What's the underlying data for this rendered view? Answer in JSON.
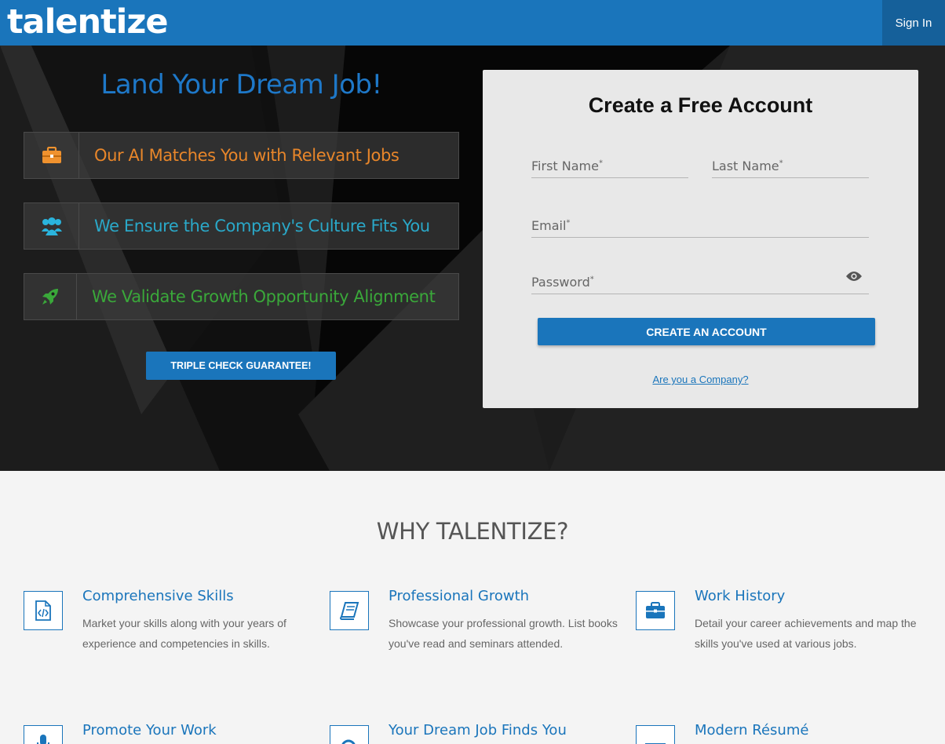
{
  "header": {
    "logo": "talentize",
    "signin_label": "Sign In"
  },
  "hero": {
    "title": "Land Your Dream Job!",
    "features": [
      {
        "icon": "briefcase-icon",
        "text": "Our AI Matches You with Relevant Jobs",
        "color": "#e8862a"
      },
      {
        "icon": "users-icon",
        "text": "We Ensure the Company's Culture Fits You",
        "color": "#2aa8c8"
      },
      {
        "icon": "rocket-icon",
        "text": "We Validate Growth Opportunity Alignment",
        "color": "#3aa83a"
      }
    ],
    "guarantee_label": "TRIPLE CHECK GUARANTEE!"
  },
  "form": {
    "title": "Create a Free Account",
    "first_name": "First Name",
    "last_name": "Last Name",
    "email": "Email",
    "password": "Password",
    "required_mark": "*",
    "submit_label": "CREATE AN ACCOUNT",
    "company_link": "Are you a Company?"
  },
  "why": {
    "title": "WHY TALENTIZE?",
    "items": [
      {
        "icon": "code-file-icon",
        "title": "Comprehensive Skills",
        "desc": "Market your skills along with your years of experience and competencies in skills."
      },
      {
        "icon": "book-icon",
        "title": "Professional Growth",
        "desc": "Showcase your professional growth. List books you've read and seminars attended."
      },
      {
        "icon": "briefcase-icon",
        "title": "Work History",
        "desc": "Detail your career achievements and map the skills you've used at various jobs."
      },
      {
        "icon": "microphone-icon",
        "title": "Promote Your Work",
        "desc": ""
      },
      {
        "icon": "search-icon",
        "title": "Your Dream Job Finds You",
        "desc": ""
      },
      {
        "icon": "envelope-icon",
        "title": "Modern Résumé",
        "desc": ""
      }
    ]
  },
  "colors": {
    "brand_blue": "#1a75bb",
    "hero_bg": "#1c1c1c"
  }
}
